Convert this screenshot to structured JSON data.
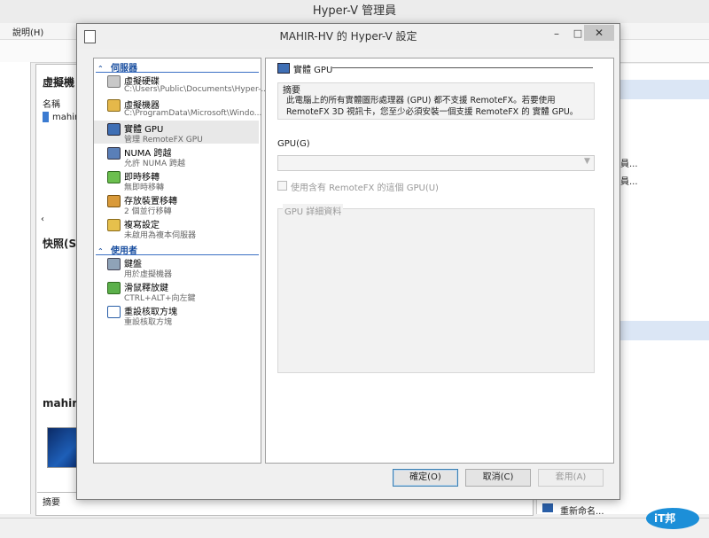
{
  "app": {
    "title": "Hyper-V 管理員",
    "menu_help": "說明(H)"
  },
  "background": {
    "vm_panel_title": "虛擬機",
    "col_name": "名稱",
    "vm_name": "mahir",
    "snapshots_title": "快照(S)",
    "details_title": "mahirl",
    "summary_tab": "摘要",
    "right_items": [
      "員...",
      "員..."
    ],
    "rename": "重新命名...",
    "logo_text": "iT邦"
  },
  "dialog": {
    "title": "MAHIR-HV 的 Hyper-V 設定",
    "controls": {
      "minimize": "–",
      "maximize": "□",
      "close": "✕"
    },
    "nav": {
      "server_section": "伺服器",
      "server_items": [
        {
          "title": "虛擬硬碟",
          "subtitle": "C:\\Users\\Public\\Documents\\Hyper-..."
        },
        {
          "title": "虛擬機器",
          "subtitle": "C:\\ProgramData\\Microsoft\\Windo..."
        },
        {
          "title": "實體 GPU",
          "subtitle": "管理 RemoteFX GPU"
        },
        {
          "title": "NUMA 跨越",
          "subtitle": "允許 NUMA 跨越"
        },
        {
          "title": "即時移轉",
          "subtitle": "無即時移轉"
        },
        {
          "title": "存放裝置移轉",
          "subtitle": "2 個並行移轉"
        },
        {
          "title": "複寫設定",
          "subtitle": "未啟用為複本伺服器"
        }
      ],
      "user_section": "使用者",
      "user_items": [
        {
          "title": "鍵盤",
          "subtitle": "用於虛擬機器"
        },
        {
          "title": "滑鼠釋放鍵",
          "subtitle": "CTRL+ALT+向左鍵"
        },
        {
          "title": "重設核取方塊",
          "subtitle": "重設核取方塊"
        }
      ]
    },
    "content": {
      "heading": "實體 GPU",
      "summary_label": "摘要",
      "summary_text": "此電腦上的所有實體圖形處理器 (GPU) 都不支援 RemoteFX。若要使用 RemoteFX 3D 視訊卡，您至少必須安裝一個支援 RemoteFX 的 實體 GPU。",
      "gpu_label": "GPU(G)",
      "gpu_value": "",
      "checkbox_label": "使用含有 RemoteFX 的這個 GPU(U)",
      "details_label": "GPU 詳細資料"
    },
    "buttons": {
      "ok": "確定(O)",
      "cancel": "取消(C)",
      "apply": "套用(A)"
    }
  }
}
